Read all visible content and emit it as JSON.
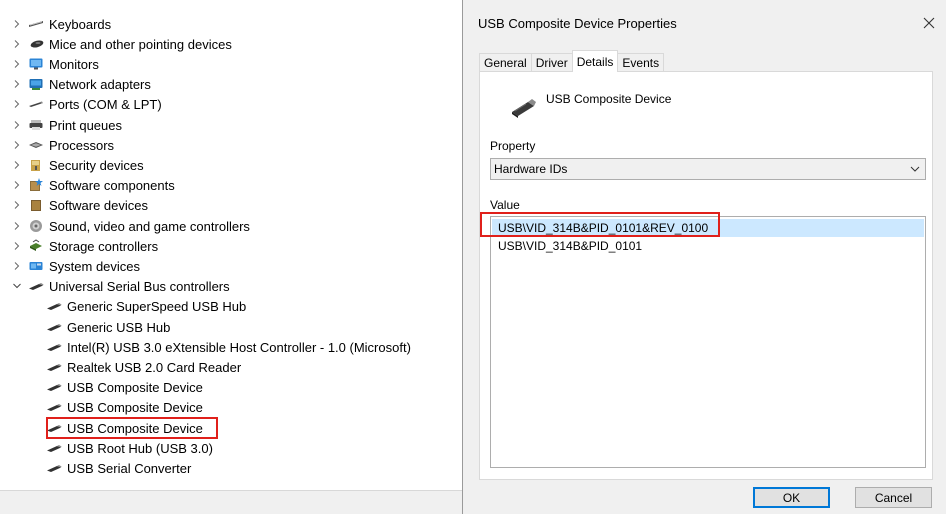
{
  "device_tree": {
    "items": [
      {
        "label": "Keyboards",
        "icon": "keyboard-icon",
        "chevron": "right",
        "indent": 0
      },
      {
        "label": "Mice and other pointing devices",
        "icon": "mouse-icon",
        "chevron": "right",
        "indent": 0
      },
      {
        "label": "Monitors",
        "icon": "monitor-icon",
        "chevron": "right",
        "indent": 0
      },
      {
        "label": "Network adapters",
        "icon": "network-adapter-icon",
        "chevron": "right",
        "indent": 0
      },
      {
        "label": "Ports (COM & LPT)",
        "icon": "port-icon",
        "chevron": "right",
        "indent": 0
      },
      {
        "label": "Print queues",
        "icon": "printer-icon",
        "chevron": "right",
        "indent": 0
      },
      {
        "label": "Processors",
        "icon": "processor-icon",
        "chevron": "right",
        "indent": 0
      },
      {
        "label": "Security devices",
        "icon": "security-device-icon",
        "chevron": "right",
        "indent": 0
      },
      {
        "label": "Software components",
        "icon": "software-component-icon",
        "chevron": "right",
        "indent": 0
      },
      {
        "label": "Software devices",
        "icon": "software-device-icon",
        "chevron": "right",
        "indent": 0
      },
      {
        "label": "Sound, video and game controllers",
        "icon": "speaker-icon",
        "chevron": "right",
        "indent": 0
      },
      {
        "label": "Storage controllers",
        "icon": "storage-controller-icon",
        "chevron": "right",
        "indent": 0
      },
      {
        "label": "System devices",
        "icon": "system-device-icon",
        "chevron": "right",
        "indent": 0
      },
      {
        "label": "Universal Serial Bus controllers",
        "icon": "usb-icon",
        "chevron": "down",
        "indent": 0
      },
      {
        "label": "Generic SuperSpeed USB Hub",
        "icon": "usb-icon",
        "chevron": "none",
        "indent": 1
      },
      {
        "label": "Generic USB Hub",
        "icon": "usb-icon",
        "chevron": "none",
        "indent": 1
      },
      {
        "label": "Intel(R) USB 3.0 eXtensible Host Controller - 1.0 (Microsoft)",
        "icon": "usb-icon",
        "chevron": "none",
        "indent": 1
      },
      {
        "label": "Realtek USB 2.0 Card Reader",
        "icon": "usb-icon",
        "chevron": "none",
        "indent": 1
      },
      {
        "label": "USB Composite Device",
        "icon": "usb-icon",
        "chevron": "none",
        "indent": 1
      },
      {
        "label": "USB Composite Device",
        "icon": "usb-icon",
        "chevron": "none",
        "indent": 1
      },
      {
        "label": "USB Composite Device",
        "icon": "usb-icon",
        "chevron": "none",
        "indent": 1,
        "highlighted": true
      },
      {
        "label": "USB Root Hub (USB 3.0)",
        "icon": "usb-icon",
        "chevron": "none",
        "indent": 1
      },
      {
        "label": "USB Serial Converter",
        "icon": "usb-icon",
        "chevron": "none",
        "indent": 1
      }
    ]
  },
  "dialog": {
    "title": "USB Composite Device Properties",
    "tabs": [
      {
        "label": "General",
        "active": false
      },
      {
        "label": "Driver",
        "active": false
      },
      {
        "label": "Details",
        "active": true
      },
      {
        "label": "Events",
        "active": false
      }
    ],
    "device_name": "USB Composite Device",
    "property_label": "Property",
    "property_selected": "Hardware IDs",
    "value_label": "Value",
    "values": [
      {
        "text": "USB\\VID_314B&PID_0101&REV_0100",
        "selected": true
      },
      {
        "text": "USB\\VID_314B&PID_0101",
        "selected": false
      }
    ],
    "ok_label": "OK",
    "cancel_label": "Cancel"
  },
  "colors": {
    "highlight_box": "#e0201b",
    "selection": "#cce8ff",
    "dialog_bg": "#f0f0f0",
    "primary_border": "#0078d7"
  }
}
